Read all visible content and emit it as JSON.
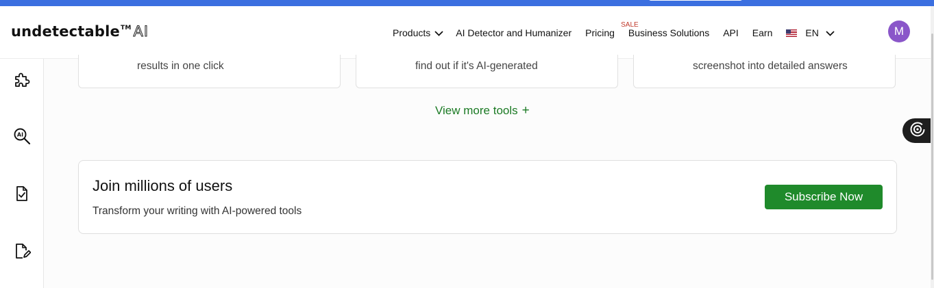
{
  "header": {
    "logo_main": "undetectable",
    "logo_tm": "TM",
    "logo_ai": "AI",
    "nav": {
      "products": "Products",
      "detector": "AI Detector and Humanizer",
      "pricing": "Pricing",
      "sale_badge": "SALE",
      "business": "Business Solutions",
      "api": "API",
      "earn": "Earn",
      "language": "EN"
    },
    "avatar_initial": "M"
  },
  "sidebar": {
    "icons": [
      "puzzle-icon",
      "ai-search-icon",
      "document-check-icon",
      "document-edit-icon"
    ]
  },
  "tool_cards": [
    {
      "text": "results in one click"
    },
    {
      "text": "find out if it's AI-generated"
    },
    {
      "text": "screenshot into detailed answers"
    }
  ],
  "view_more": {
    "label": "View more tools",
    "plus": "+"
  },
  "promo": {
    "title": "Join millions of users",
    "subtitle": "Transform your writing with AI-powered tools",
    "button_label": "Subscribe Now"
  },
  "colors": {
    "banner": "#3b6fe0",
    "accent_green": "#1f8a2b",
    "avatar": "#8a56c9",
    "sale_red": "#c0392b"
  }
}
